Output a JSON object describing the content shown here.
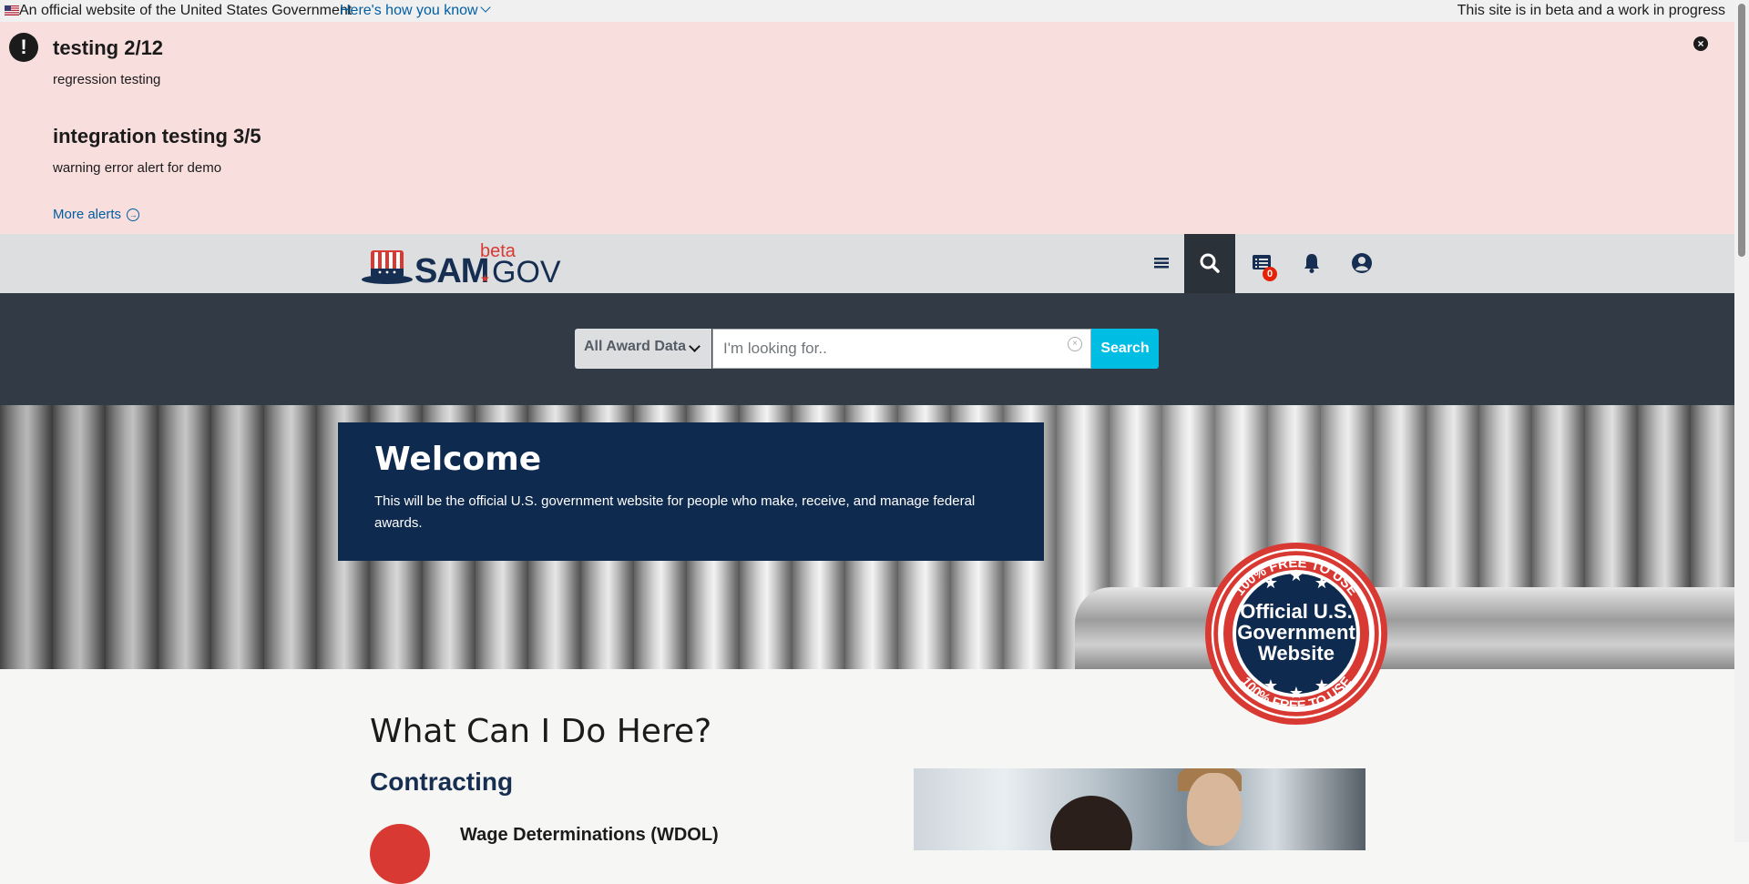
{
  "banner": {
    "gov_text": "An official website of the United States Government",
    "how_link": "Here's how you know",
    "beta_text": "This site is in beta and a work in progress"
  },
  "alerts": [
    {
      "title": "testing 2/12",
      "body": "regression testing"
    },
    {
      "title": "integration testing 3/5",
      "body": "warning error alert for demo"
    }
  ],
  "more_alerts": "More alerts",
  "header": {
    "logo": {
      "sam": "SAM",
      "beta": "beta",
      "gov": "GOV"
    },
    "notification_count": "0",
    "icons": [
      "menu-icon",
      "search-icon",
      "list-icon",
      "bell-icon",
      "user-icon"
    ]
  },
  "search": {
    "domain_selected": "All Award Data",
    "placeholder": "I'm looking for..",
    "button_label": "Search"
  },
  "welcome": {
    "title": "Welcome",
    "text": "This will be the official U.S. government website for people who make, receive, and manage federal awards."
  },
  "seal": {
    "ring_text_top": "100% FREE TO USE",
    "ring_text_bottom": "100% FREE TO USE",
    "line1": "Official U.S.",
    "line2": "Government",
    "line3": "Website"
  },
  "content": {
    "title": "What Can I Do Here?",
    "section": "Contracting",
    "item_title": "Wage Determinations (WDOL)"
  },
  "colors": {
    "navy": "#0f2a4f",
    "alert_bg": "#f9dede",
    "search_button": "#00bde3",
    "accent_red": "#d83933",
    "link": "#005ea2"
  }
}
